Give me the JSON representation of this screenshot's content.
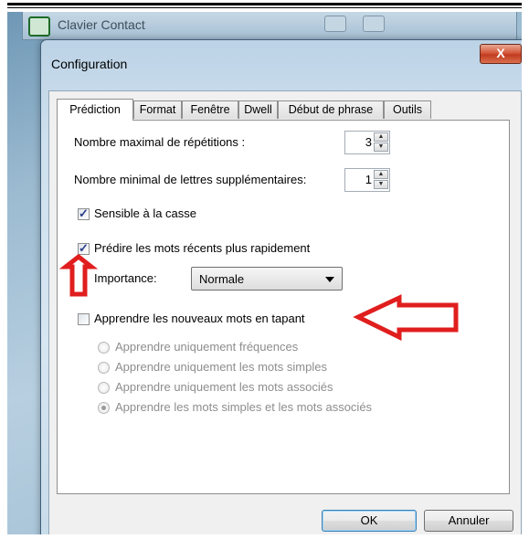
{
  "parent_window": {
    "title": "Clavier Contact"
  },
  "dialog": {
    "title": "Configuration",
    "close_label": "X",
    "tabs": [
      {
        "label": "Prédiction"
      },
      {
        "label": "Format"
      },
      {
        "label": "Fenêtre"
      },
      {
        "label": "Dwell"
      },
      {
        "label": "Début de phrase"
      },
      {
        "label": "Outils"
      }
    ],
    "active_tab": "Prédiction",
    "prediction": {
      "max_repetitions_label": "Nombre maximal de répétitions :",
      "max_repetitions_value": "3",
      "min_letters_label": "Nombre minimal de lettres supplémentaires:",
      "min_letters_value": "1",
      "case_sensitive_label": "Sensible à la casse",
      "case_sensitive_checked": true,
      "predict_recent_label": "Prédire les mots récents plus rapidement",
      "predict_recent_checked": true,
      "importance_label": "Importance:",
      "importance_value": "Normale",
      "learn_label": "Apprendre les nouveaux mots en tapant",
      "learn_checked": false,
      "learn_options": [
        {
          "label": "Apprendre uniquement fréquences",
          "selected": false
        },
        {
          "label": "Apprendre uniquement les mots simples",
          "selected": false
        },
        {
          "label": "Apprendre uniquement les mots associés",
          "selected": false
        },
        {
          "label": "Apprendre les mots simples et les mots associés",
          "selected": true
        }
      ]
    },
    "buttons": {
      "ok": "OK",
      "cancel": "Annuler"
    }
  },
  "annotation_color": "#e01e1e"
}
